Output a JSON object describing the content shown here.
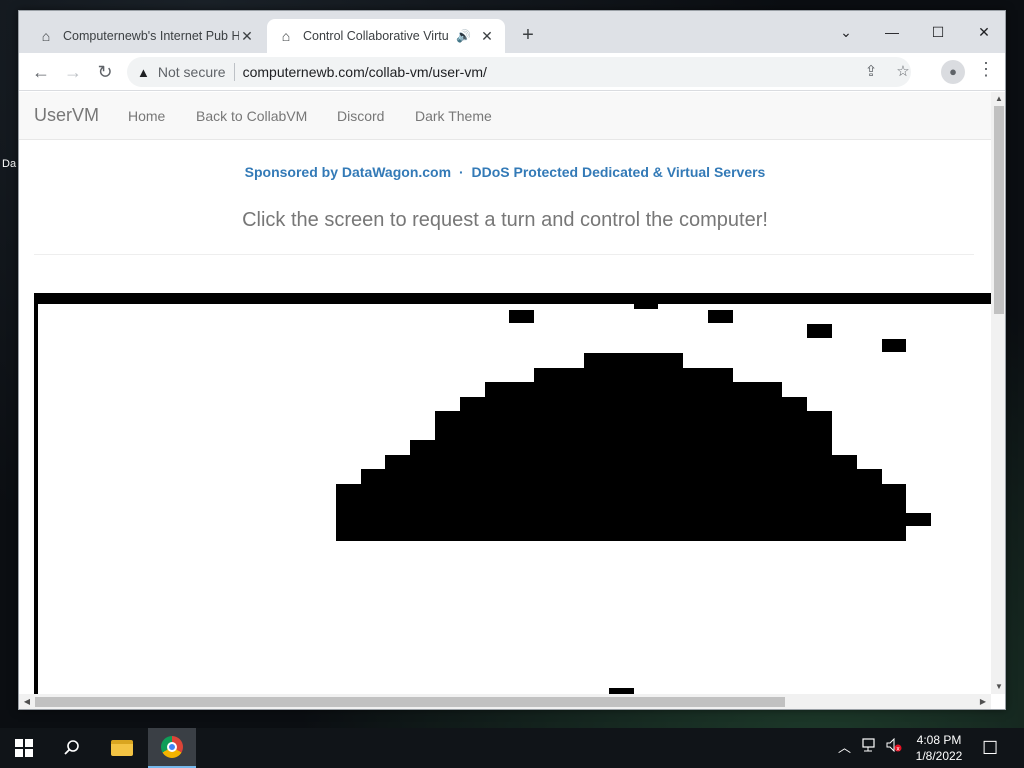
{
  "desktop": {
    "icon_label": "Da"
  },
  "browser": {
    "tabs": [
      {
        "title": "Computernewb's Internet Pub Hub",
        "active": false
      },
      {
        "title": "Control Collaborative Virtual Machines",
        "active": true
      }
    ],
    "new_tab_glyph": "+",
    "window_controls": {
      "dropdown": "⌄",
      "minimize": "—",
      "maximize": "☐",
      "close": "✕"
    },
    "toolbar": {
      "back": "←",
      "forward": "→",
      "reload": "↻",
      "security_icon": "▲",
      "security_text": "Not secure",
      "url": "computernewb.com/collab-vm/user-vm/",
      "share_icon": "⇪",
      "bookmark_icon": "☆",
      "menu_icon": "⋮",
      "profile_icon": "●"
    }
  },
  "page": {
    "brand": "UserVM",
    "nav_links": [
      "Home",
      "Back to CollabVM",
      "Discord",
      "Dark Theme"
    ],
    "sponsor": {
      "part1": "Sponsored by DataWagon.com",
      "separator": "·",
      "part2": "DDoS Protected Dedicated & Virtual Servers"
    },
    "instruction": "Click the screen to request a turn and control the computer!"
  },
  "taskbar": {
    "clock_time": "4:08 PM",
    "clock_date": "1/8/2022",
    "tray_up": "︿",
    "notification_glyph": "☐"
  },
  "colors": {
    "link_blue": "#337ab7",
    "nav_gray": "#777777",
    "tab_strip": "#dee1e6"
  }
}
